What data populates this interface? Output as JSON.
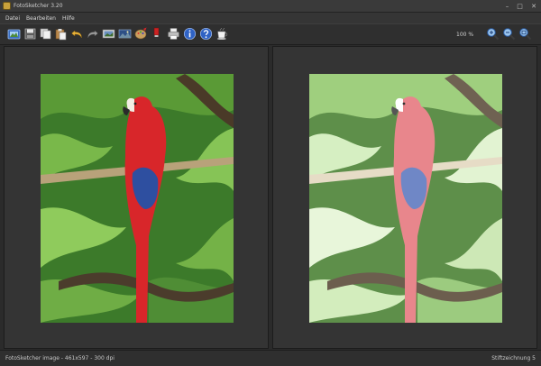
{
  "window": {
    "title": "FotoSketcher 3.20",
    "minimize_glyph": "–",
    "maximize_glyph": "□",
    "close_glyph": "✕"
  },
  "menu": [
    {
      "label": "Datei"
    },
    {
      "label": "Bearbeiten"
    },
    {
      "label": "Hilfe"
    }
  ],
  "toolbar": {
    "zoom_level": "100 %",
    "buttons": [
      {
        "icon": "open-image-icon"
      },
      {
        "icon": "save-icon"
      },
      {
        "icon": "copy-icon"
      },
      {
        "icon": "paste-icon"
      },
      {
        "icon": "undo-icon"
      },
      {
        "icon": "redo-icon"
      },
      {
        "icon": "image-settings-icon"
      },
      {
        "icon": "landscape-icon"
      },
      {
        "icon": "palette-icon"
      },
      {
        "icon": "brush-icon"
      },
      {
        "icon": "print-icon"
      },
      {
        "icon": "info-icon"
      },
      {
        "icon": "help-icon"
      },
      {
        "icon": "coffee-icon"
      },
      {
        "icon": "zoom-in-icon"
      },
      {
        "icon": "zoom-out-icon"
      },
      {
        "icon": "zoom-fit-icon"
      }
    ]
  },
  "status": {
    "left": "FotoSketcher image - 461x597 - 300 dpi",
    "right": "Stiftzeichnung 5"
  },
  "colors": {
    "accent_red": "#d8262a",
    "parrot_blue": "#2e4fa0",
    "foliage_green": "#3f8a2a"
  }
}
